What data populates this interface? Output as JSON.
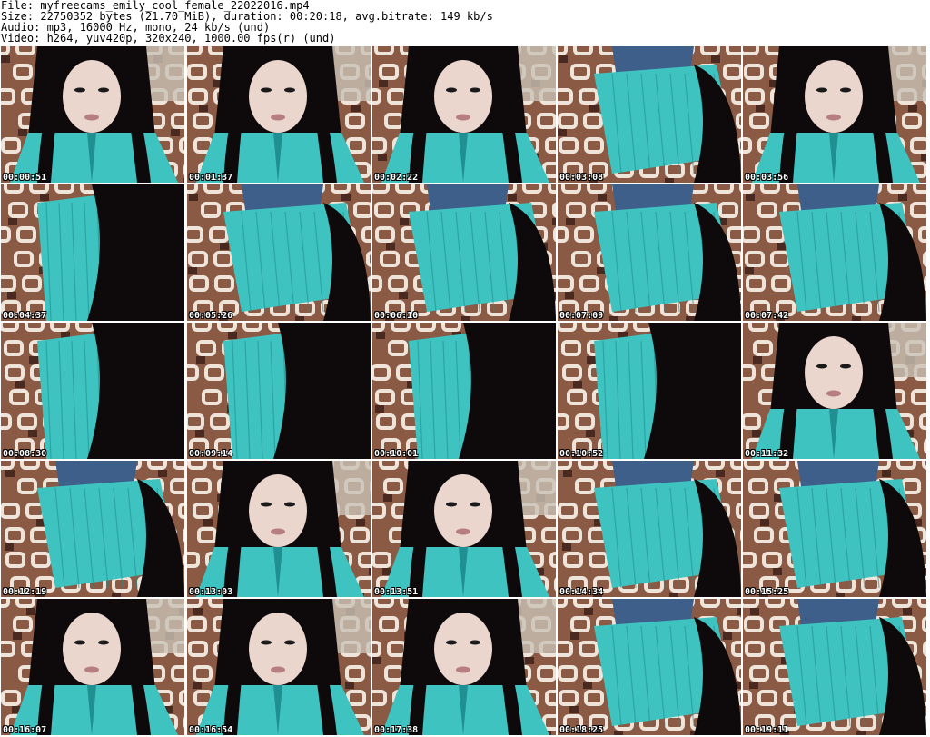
{
  "header": {
    "lines": [
      "File: myfreecams_emily_cool_female_22022016.mp4",
      "Size: 22750352 bytes (21.70 MiB), duration: 00:20:18, avg.bitrate: 149 kb/s",
      "Audio: mp3, 16000 Hz, mono, 24 kb/s (und)",
      "Video: h264, yuv420p, 320x240, 1000.00 fps(r) (und)"
    ]
  },
  "thumbnails": [
    {
      "timestamp": "00:00:51",
      "scene": "face"
    },
    {
      "timestamp": "00:01:37",
      "scene": "face"
    },
    {
      "timestamp": "00:02:22",
      "scene": "face"
    },
    {
      "timestamp": "00:03:08",
      "scene": "lying"
    },
    {
      "timestamp": "00:03:56",
      "scene": "face"
    },
    {
      "timestamp": "00:04:37",
      "scene": "hair"
    },
    {
      "timestamp": "00:05:26",
      "scene": "lying"
    },
    {
      "timestamp": "00:06:10",
      "scene": "lying"
    },
    {
      "timestamp": "00:07:09",
      "scene": "lying"
    },
    {
      "timestamp": "00:07:42",
      "scene": "lying"
    },
    {
      "timestamp": "00:08:30",
      "scene": "hair"
    },
    {
      "timestamp": "00:09:14",
      "scene": "hair"
    },
    {
      "timestamp": "00:10:01",
      "scene": "hair"
    },
    {
      "timestamp": "00:10:52",
      "scene": "hair"
    },
    {
      "timestamp": "00:11:32",
      "scene": "face"
    },
    {
      "timestamp": "00:12:19",
      "scene": "lying"
    },
    {
      "timestamp": "00:13:03",
      "scene": "face"
    },
    {
      "timestamp": "00:13:51",
      "scene": "face"
    },
    {
      "timestamp": "00:14:34",
      "scene": "lying"
    },
    {
      "timestamp": "00:15:25",
      "scene": "lying"
    },
    {
      "timestamp": "00:16:07",
      "scene": "face"
    },
    {
      "timestamp": "00:16:54",
      "scene": "face"
    },
    {
      "timestamp": "00:17:38",
      "scene": "face"
    },
    {
      "timestamp": "00:18:25",
      "scene": "lying"
    },
    {
      "timestamp": "00:19:11",
      "scene": "lying"
    }
  ],
  "colors": {
    "shirt": "#3fc3c0",
    "shirt_dark": "#1f8f92",
    "hair": "#0e0a0c",
    "skin": "#ead6cc",
    "blanket_bg": "#8a5a44",
    "blanket_light": "#efe4d9",
    "blanket_dark": "#4a2a20",
    "jeans": "#3e5f8a",
    "wall": "#c9c2b6"
  }
}
